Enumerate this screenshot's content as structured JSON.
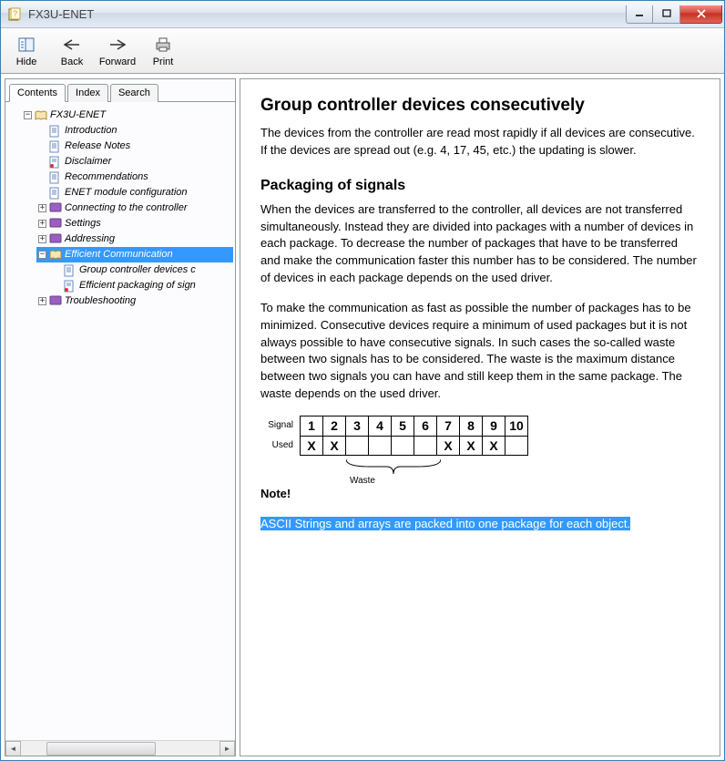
{
  "window": {
    "title": "FX3U-ENET"
  },
  "toolbar": {
    "hide": "Hide",
    "back": "Back",
    "forward": "Forward",
    "print": "Print"
  },
  "tabs": {
    "contents": "Contents",
    "index": "Index",
    "search": "Search"
  },
  "tree": {
    "root": "FX3U-ENET",
    "introduction": "Introduction",
    "release_notes": "Release Notes",
    "disclaimer": "Disclaimer",
    "recommendations": "Recommendations",
    "enet_config": "ENET module configuration",
    "connecting": "Connecting to the controller",
    "settings": "Settings",
    "addressing": "Addressing",
    "efficient": "Efficient Communication",
    "group_devices": "Group controller devices c",
    "packaging": "Efficient packaging of sign",
    "troubleshooting": "Troubleshooting"
  },
  "article": {
    "h1": "Group controller devices consecutively",
    "p1": "The devices from the controller are read most rapidly if all devices are consecutive. If the devices are spread out (e.g. 4, 17, 45, etc.) the updating is slower.",
    "h2": "Packaging of signals",
    "p2": "When the devices are transferred to the controller, all devices are not transferred simultaneously. Instead they are divided into packages with a number of devices in each package. To decrease the number of packages that have to be transferred and make the communication faster this number has to be considered. The number of devices in each package depends on the used driver.",
    "p3": "To make the communication as fast as possible the number of packages has to be minimized. Consecutive devices require a minimum of used packages but it is not always possible to have consecutive signals. In such cases the so-called waste between two signals has to be considered. The waste is the maximum distance between two signals you can have and still keep them in the same package. The waste depends on the used driver.",
    "row_signal_label": "Signal",
    "row_used_label": "Used",
    "waste_label": "Waste",
    "note_head": "Note!",
    "note_body": "ASCII Strings and arrays are packed into one package for each object."
  },
  "chart_data": {
    "type": "table",
    "title": "Signal / Used waste illustration",
    "columns": [
      "1",
      "2",
      "3",
      "4",
      "5",
      "6",
      "7",
      "8",
      "9",
      "10"
    ],
    "rows": [
      {
        "name": "Signal",
        "values": [
          "1",
          "2",
          "3",
          "4",
          "5",
          "6",
          "7",
          "8",
          "9",
          "10"
        ]
      },
      {
        "name": "Used",
        "values": [
          "X",
          "X",
          "",
          "",
          "",
          "",
          "X",
          "X",
          "X",
          ""
        ]
      }
    ],
    "waste_range": {
      "from_col": 3,
      "to_col": 6,
      "label": "Waste"
    }
  }
}
